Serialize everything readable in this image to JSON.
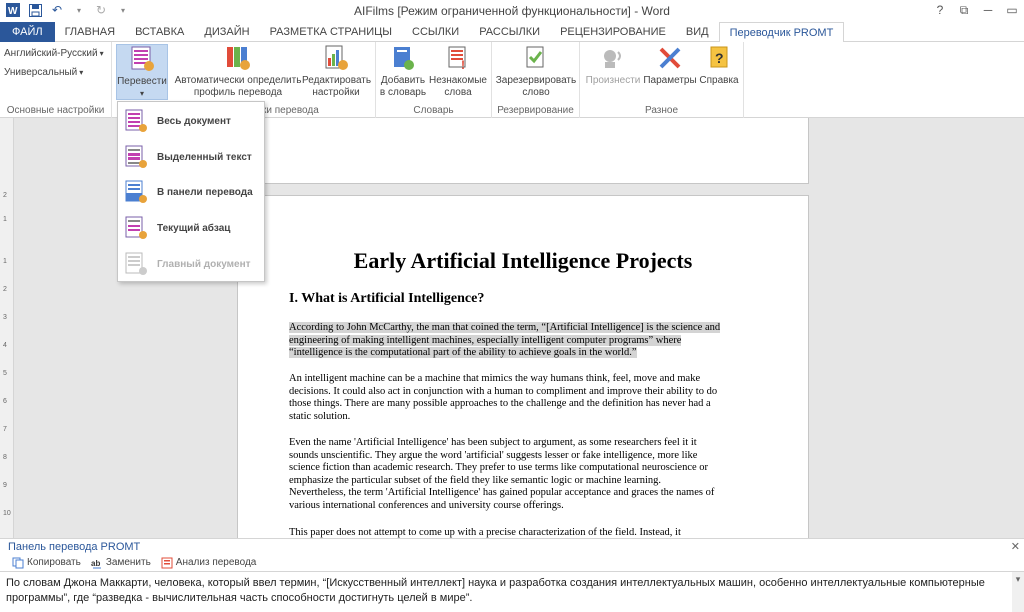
{
  "window": {
    "title": "AIFilms [Режим ограниченной функциональности] - Word",
    "help": "?",
    "restore": "⧉",
    "minimize": "─",
    "maximize": "▭"
  },
  "tabs": [
    {
      "label": "ФАЙЛ"
    },
    {
      "label": "ГЛАВНАЯ"
    },
    {
      "label": "ВСТАВКА"
    },
    {
      "label": "ДИЗАЙН"
    },
    {
      "label": "РАЗМЕТКА СТРАНИЦЫ"
    },
    {
      "label": "ССЫЛКИ"
    },
    {
      "label": "РАССЫЛКИ"
    },
    {
      "label": "РЕЦЕНЗИРОВАНИЕ"
    },
    {
      "label": "ВИД"
    },
    {
      "label": "Переводчик PROMT"
    }
  ],
  "ribbon": {
    "basic": {
      "direction": "Английский-Русский",
      "profile": "Универсальный",
      "label": "Основные настройки"
    },
    "translate": {
      "translate_label": "Перевести",
      "auto_label_1": "Автоматически определить",
      "auto_label_2": "профиль перевода",
      "edit_label_1": "Редактировать",
      "edit_label_2": "настройки",
      "group_label": "ки перевода"
    },
    "dictionary": {
      "add_1": "Добавить",
      "add_2": "в словарь",
      "unknown_1": "Незнакомые",
      "unknown_2": "слова",
      "label": "Словарь"
    },
    "reserve": {
      "reserve_1": "Зарезервировать",
      "reserve_2": "слово",
      "label": "Резервирование"
    },
    "misc": {
      "speak": "Произнести",
      "params": "Параметры",
      "help": "Справка",
      "label": "Разное"
    }
  },
  "menu": [
    {
      "label": "Весь документ",
      "enabled": true
    },
    {
      "label": "Выделенный текст",
      "enabled": true
    },
    {
      "label": "В панели перевода",
      "enabled": true
    },
    {
      "label": "Текущий абзац",
      "enabled": true
    },
    {
      "label": "Главный документ",
      "enabled": false
    }
  ],
  "document": {
    "title": "Early Artificial Intelligence Projects",
    "heading": "I. What is Artificial Intelligence?",
    "p1_l1": "According to John McCarthy, the man that coined the term, “[Artificial Intelligence] is the science and",
    "p1_l2": "engineering of making intelligent machines, especially intelligent computer programs” where",
    "p1_l3": "“intelligence is the computational part of the ability to achieve goals in the world.”",
    "p2_l1": "An intelligent machine can be a machine that mimics the way humans think, feel, move and make",
    "p2_l2": "decisions.  It could also act in conjunction with a human to compliment and improve their ability to do",
    "p2_l3": "those things.  There are many possible approaches to the challenge and the definition has never had a",
    "p2_l4": "static solution.",
    "p3_l1": "Even the name 'Artificial Intelligence' has been subject to argument, as some researchers feel it it",
    "p3_l2": "sounds unscientific.  They argue the word 'artificial' suggests lesser or fake intelligence, more like",
    "p3_l3": "science fiction than academic research.  They prefer to use terms like computational neuroscience or",
    "p3_l4": "emphasize the particular subset of the field they  like semantic logic or machine learning.",
    "p3_l5": "Nevertheless, the term 'Artificial Intelligence' has gained popular acceptance and graces the names of",
    "p3_l6": "various international conferences and university course offerings.",
    "p4_l1": "This paper does not attempt to come up with a precise characterization of the field.  Instead, it"
  },
  "ruler": [
    "2",
    "1",
    "1",
    "2",
    "3",
    "4",
    "5",
    "6",
    "7",
    "8",
    "9",
    "10"
  ],
  "panel": {
    "title": "Панель перевода PROMT",
    "close": "✕",
    "scroll": "▾",
    "copy": "Копировать",
    "replace": "Заменить",
    "analyze": "Анализ перевода",
    "text": "По словам Джона Маккарти, человека, который ввел термин, “[Искусственный интеллект] наука и разработка создания интеллектуальных машин, особенно интеллектуальные компьютерные программы”, где “разведка - вычислительная часть способности достигнуть целей в мире”."
  },
  "colors": {
    "accent": "#2b579a",
    "selection": "#d4d4d4"
  }
}
